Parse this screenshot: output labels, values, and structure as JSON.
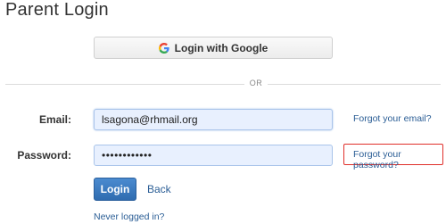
{
  "header": {
    "title": "Parent Login"
  },
  "google": {
    "label": "Login with Google",
    "icon": "google-icon"
  },
  "divider": {
    "text": "OR"
  },
  "form": {
    "email_label": "Email:",
    "email_value": "lsagona@rhmail.org",
    "password_label": "Password:",
    "password_value": "••••••••••••",
    "forgot_email": "Forgot your email?",
    "forgot_password": "Forgot your password?"
  },
  "actions": {
    "login_label": "Login",
    "back_label": "Back",
    "never_logged_in": "Never logged in?"
  },
  "colors": {
    "link": "#2a5d95",
    "login_button": "#3a78bf",
    "input_bg": "#e8f0fe",
    "highlight_box": "#e0302b"
  }
}
